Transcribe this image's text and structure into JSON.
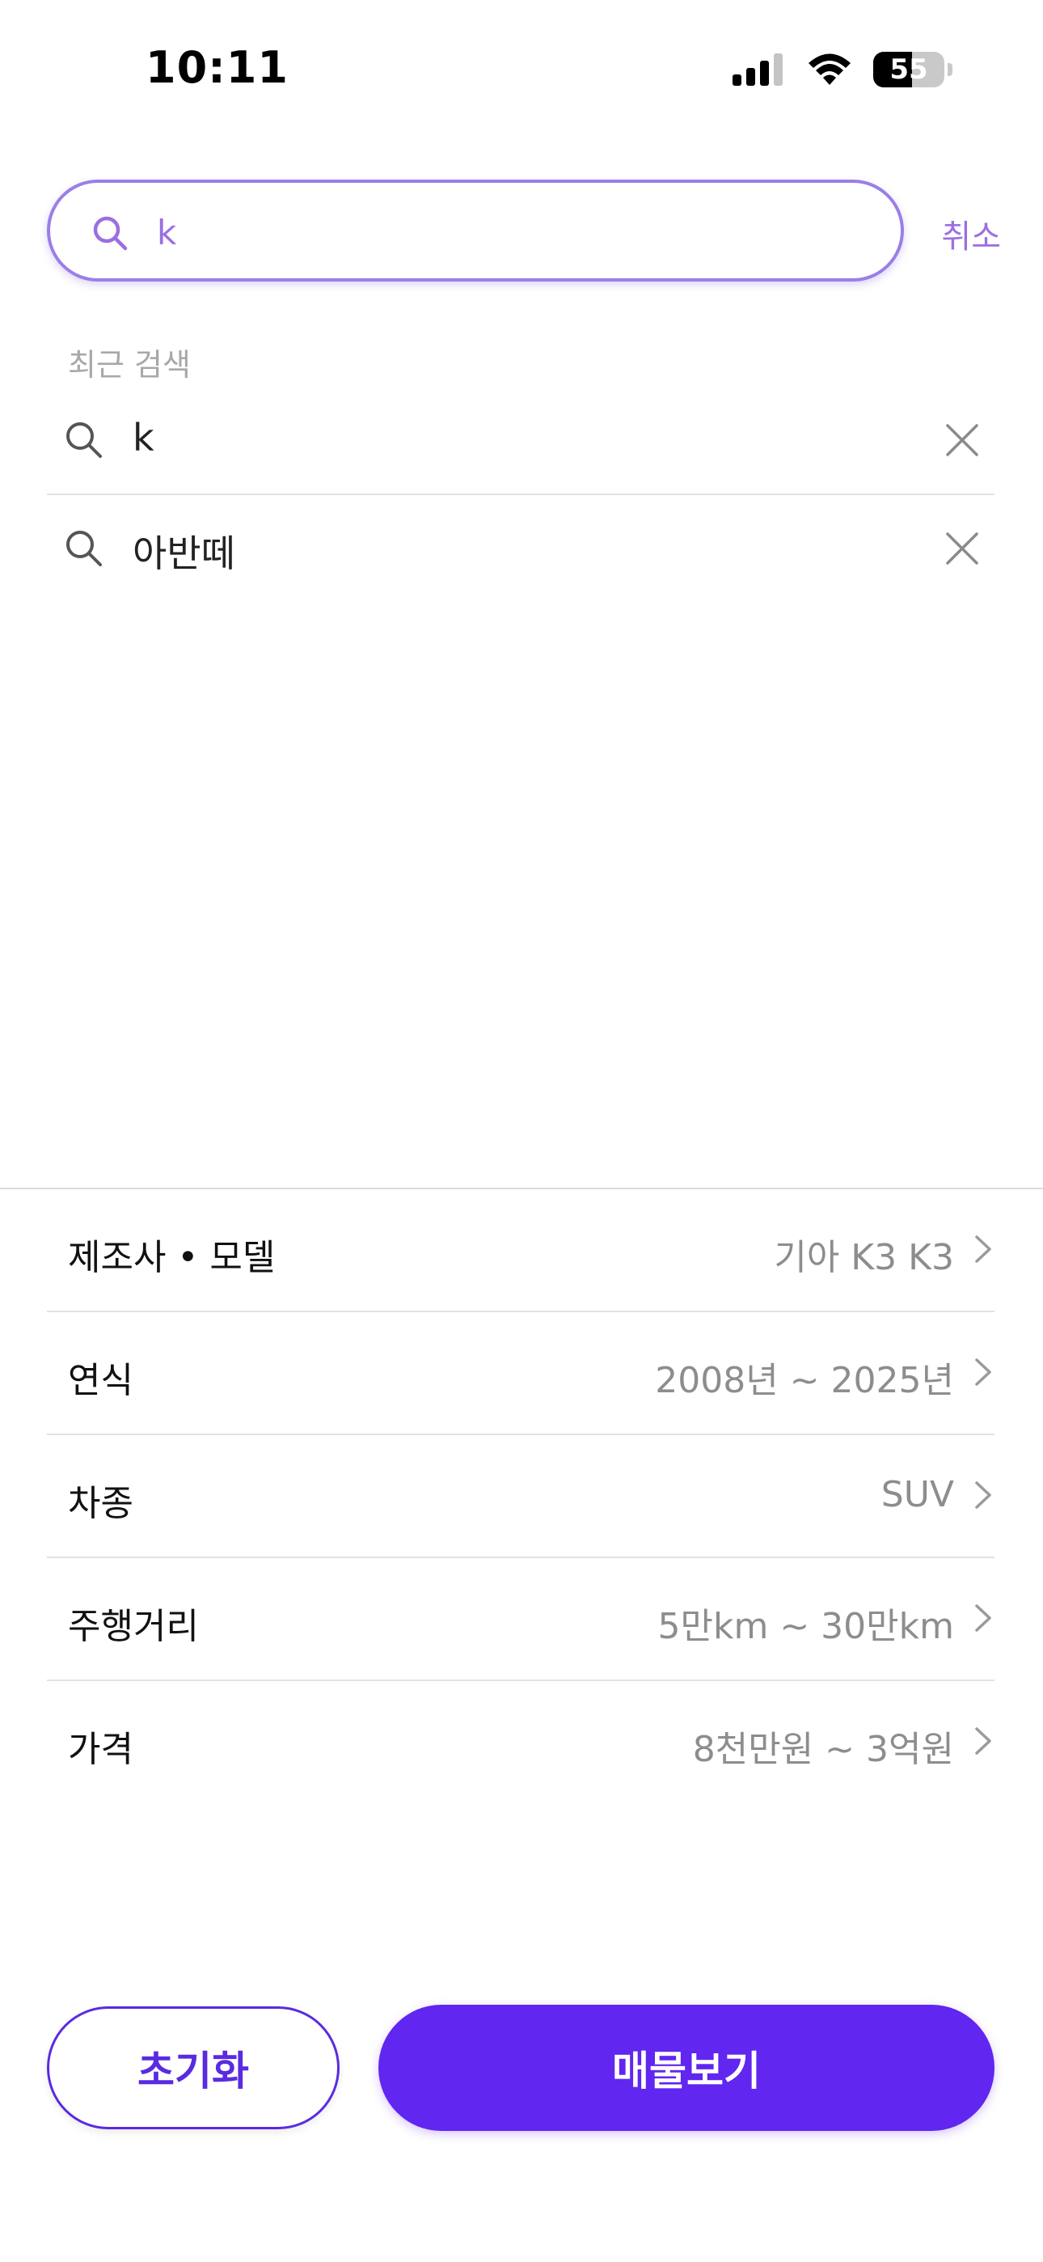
{
  "status_bar": {
    "time": "10:11",
    "battery": "55"
  },
  "search": {
    "value": "k",
    "cancel_label": "취소"
  },
  "recent": {
    "title": "최근 검색",
    "items": [
      {
        "label": "k"
      },
      {
        "label": "아반떼"
      }
    ]
  },
  "filters": [
    {
      "label": "제조사 • 모델",
      "value": "기아 K3 K3"
    },
    {
      "label": "연식",
      "value": "2008년 ~ 2025년"
    },
    {
      "label": "차종",
      "value": "SUV"
    },
    {
      "label": "주행거리",
      "value": "5만km ~ 30만km"
    },
    {
      "label": "가격",
      "value": "8천만원 ~ 3억원"
    }
  ],
  "actions": {
    "reset_label": "초기화",
    "view_label": "매물보기"
  },
  "colors": {
    "accent": "#6126f0",
    "accent_light": "#9b7ee8",
    "muted": "#8d8d8d"
  },
  "icons": [
    "search-icon",
    "close-icon",
    "chevron-right-icon",
    "signal-icon",
    "wifi-icon",
    "battery-icon"
  ]
}
